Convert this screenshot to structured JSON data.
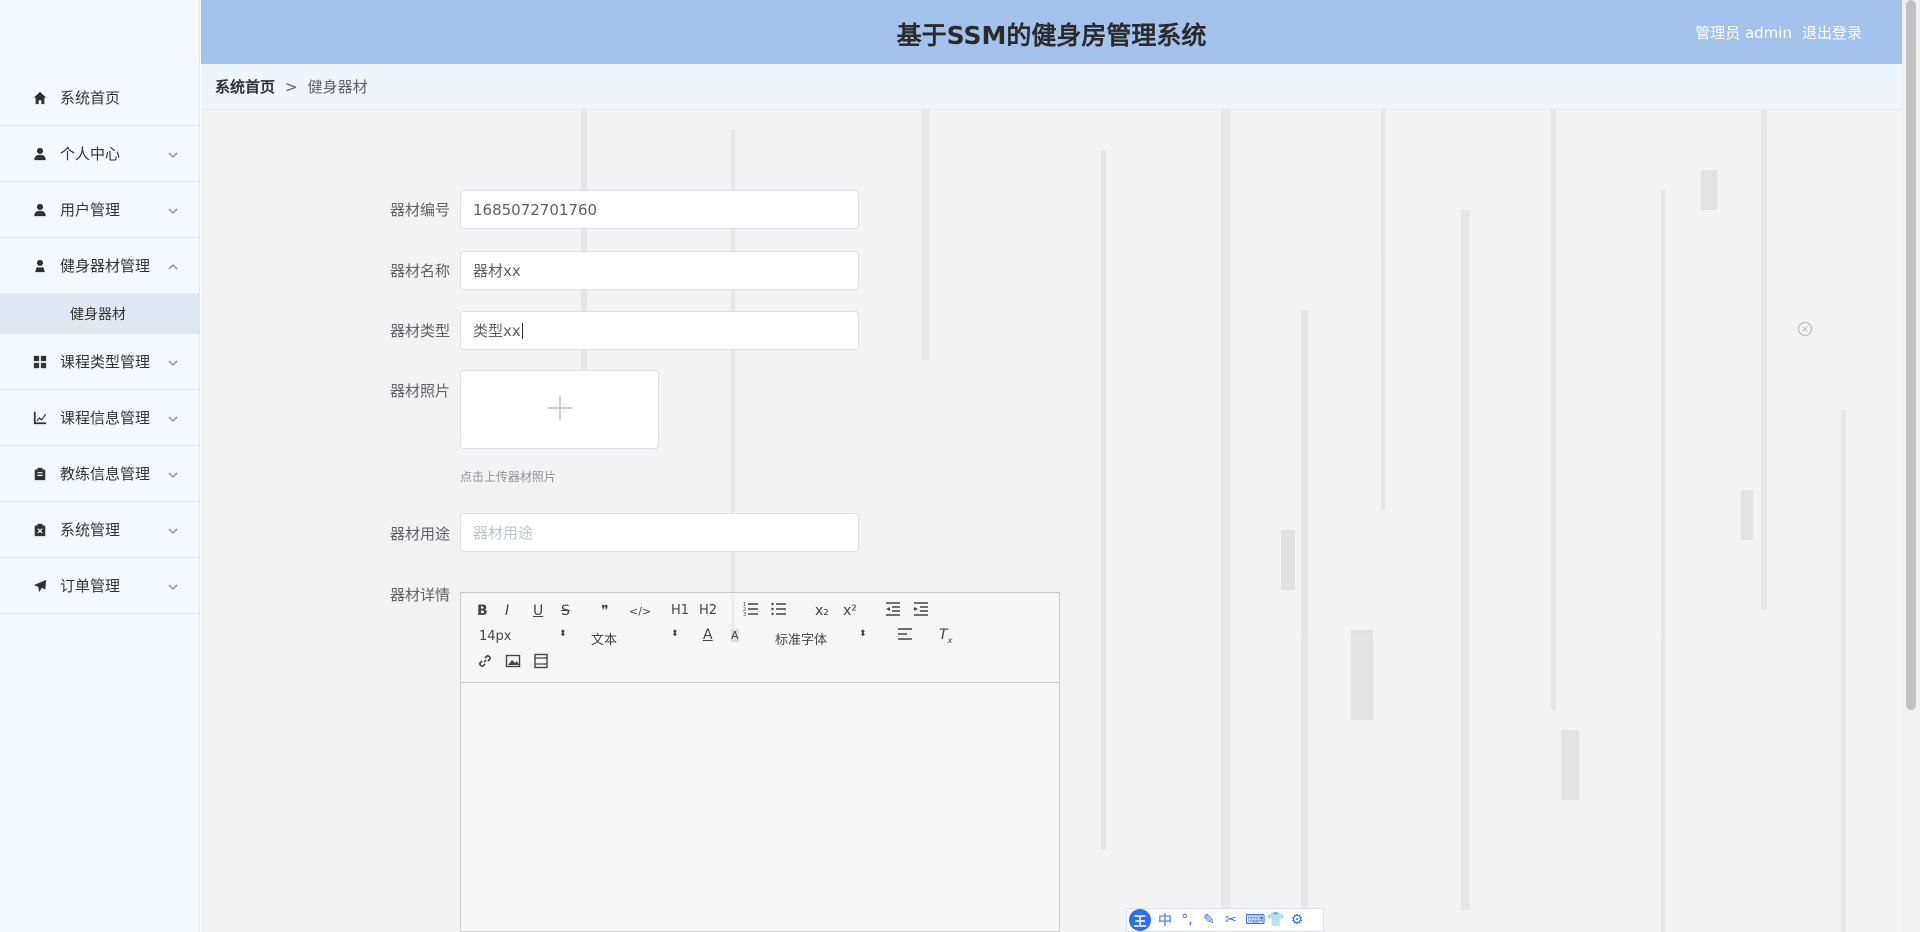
{
  "header": {
    "title": "基于SSM的健身房管理系统",
    "user_label": "管理员 admin",
    "logout_label": "退出登录"
  },
  "sidebar": {
    "items": [
      {
        "label": "系统首页",
        "icon": "home-icon"
      },
      {
        "label": "个人中心",
        "icon": "user-icon"
      },
      {
        "label": "用户管理",
        "icon": "user-icon"
      },
      {
        "label": "健身器材管理",
        "icon": "user-icon"
      },
      {
        "label": "课程类型管理",
        "icon": "grid-icon"
      },
      {
        "label": "课程信息管理",
        "icon": "chart-icon"
      },
      {
        "label": "教练信息管理",
        "icon": "clipboard-icon"
      },
      {
        "label": "系统管理",
        "icon": "clipboard-x-icon"
      },
      {
        "label": "订单管理",
        "icon": "send-icon"
      }
    ],
    "sub_item": "健身器材"
  },
  "breadcrumb": {
    "home": "系统首页",
    "separator": ">",
    "current": "健身器材"
  },
  "form": {
    "code": {
      "label": "器材编号",
      "value": "1685072701760"
    },
    "name": {
      "label": "器材名称",
      "value": "器材xx"
    },
    "type": {
      "label": "器材类型",
      "value": "类型xx"
    },
    "photo": {
      "label": "器材照片",
      "tip": "点击上传器材照片"
    },
    "usage": {
      "label": "器材用途",
      "placeholder": "器材用途"
    },
    "detail": {
      "label": "器材详情"
    }
  },
  "editor": {
    "font_size": "14px",
    "header_select": "文本",
    "font_family": "标准字体",
    "buttons": [
      "B",
      "I",
      "U",
      "S",
      "❞",
      "</>",
      "H1",
      "H2",
      "x₂",
      "x²"
    ]
  },
  "ime": {
    "logo": "王",
    "lang": "中"
  },
  "colors": {
    "header_bg": "#a3c3ec",
    "sidebar_bg": "#f4f9fd",
    "active_sub_bg": "#dde8f2"
  }
}
